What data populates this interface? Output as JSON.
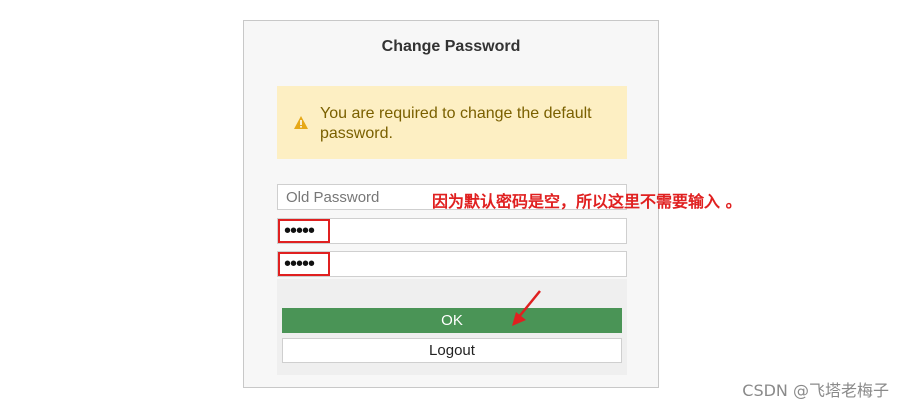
{
  "dialog": {
    "title": "Change Password",
    "warning": {
      "icon": "warning-icon",
      "message": "You are required to change the default password."
    },
    "fields": {
      "old_password_placeholder": "Old Password",
      "new_password_value": "•••••",
      "confirm_password_value": "•••••"
    },
    "buttons": {
      "ok": "OK",
      "logout": "Logout"
    }
  },
  "annotation": {
    "text": "因为默认密码是空，所以这里不需要输入 。",
    "color": "#e02020"
  },
  "watermark": "CSDN @飞塔老梅子",
  "colors": {
    "ok_button": "#4a9456",
    "warning_bg": "#fdefc3",
    "warning_text": "#7a6000"
  }
}
